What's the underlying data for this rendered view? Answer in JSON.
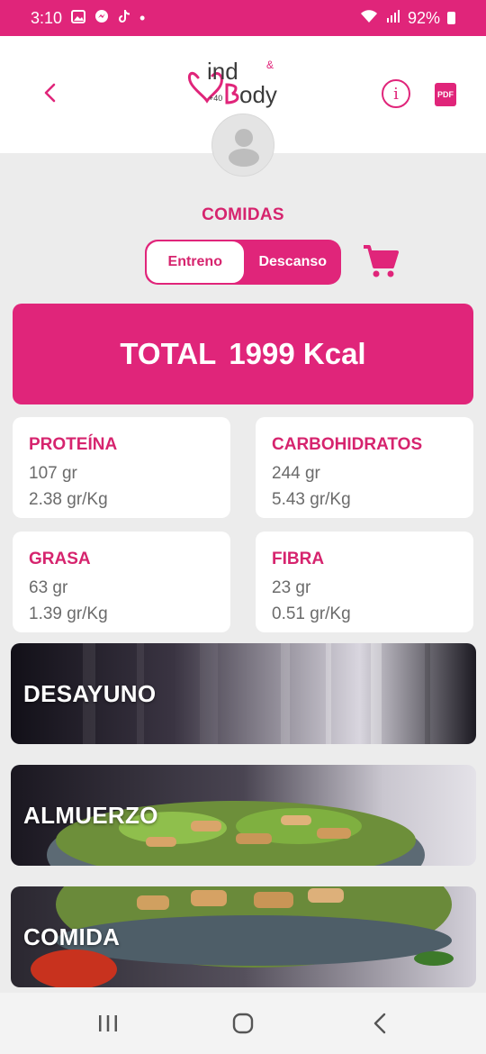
{
  "status_bar": {
    "time": "3:10",
    "dot": "•",
    "battery": "92%",
    "icons": [
      "gallery-icon",
      "messenger-icon",
      "tiktok-icon",
      "wifi-icon",
      "signal-icon",
      "battery-icon"
    ]
  },
  "header": {
    "brand_top": "ind",
    "brand_amp": "&",
    "brand_bottom": "ody",
    "brand_age": "+40",
    "pdf_label": "PDF",
    "info_label": "i"
  },
  "section": {
    "title": "COMIDAS"
  },
  "toggle": {
    "option_1": "Entreno",
    "option_2": "Descanso",
    "selected": "Descanso"
  },
  "total": {
    "label": "TOTAL",
    "value": "1999 Kcal"
  },
  "macros": [
    {
      "title": "PROTEÍNA",
      "grams": "107 gr",
      "per_kg": "2.38 gr/Kg"
    },
    {
      "title": "CARBOHIDRATOS",
      "grams": "244 gr",
      "per_kg": "5.43 gr/Kg"
    },
    {
      "title": "GRASA",
      "grams": "63 gr",
      "per_kg": "1.39 gr/Kg"
    },
    {
      "title": "FIBRA",
      "grams": "23 gr",
      "per_kg": "0.51 gr/Kg"
    }
  ],
  "meals": [
    {
      "label": "DESAYUNO"
    },
    {
      "label": "ALMUERZO"
    },
    {
      "label": "COMIDA"
    }
  ],
  "colors": {
    "accent": "#e0257a",
    "accent_text": "#d6246e",
    "card_bg": "#ffffff",
    "page_bg": "#ececec",
    "muted_text": "#6b6b6b"
  }
}
